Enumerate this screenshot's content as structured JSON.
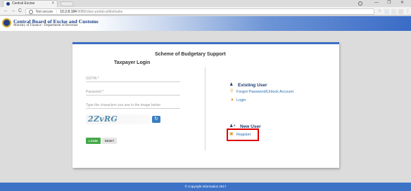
{
  "browser": {
    "tab_title": "Central Excise",
    "tab_close": "×",
    "nav": {
      "back": "←",
      "forward": "→",
      "reload": "C"
    },
    "address": {
      "security": "Not secure",
      "separator": "|",
      "host": "10.2.8.184",
      "path": ":9080/cbec-portal-ui/dist/sabs"
    },
    "window_controls": {
      "minimize": "—",
      "maximize": "❐",
      "close": "✕"
    }
  },
  "header": {
    "org_name": "Central Board of Excise and Customs",
    "org_sub": "Ministry of Finance - Department of Revenue"
  },
  "page": {
    "scheme_title": "Scheme of Budgetary Support",
    "login": {
      "title": "Taxpayer Login",
      "gstin_placeholder": "GSTIN *",
      "password_placeholder": "Password *",
      "captcha_placeholder": "Type the characters you see in the image below",
      "captcha_text": "2ZvRG",
      "refresh_icon": "↻",
      "login_label": "LOGIN",
      "reset_label": "RESET"
    },
    "existing_user": {
      "heading": "Existing User",
      "forgot_link": "Forgot Password/Unlock Account",
      "login_link": "Login"
    },
    "new_user": {
      "heading": "New User",
      "register_link": "Register"
    }
  },
  "footer": {
    "text": "© Copyright Information 2017"
  },
  "colors": {
    "brand_blue": "#3d72c7",
    "header_text": "#1c3f86",
    "link": "#2a6eb0",
    "login_green": "#45a84a",
    "highlight_red": "#e00000"
  }
}
